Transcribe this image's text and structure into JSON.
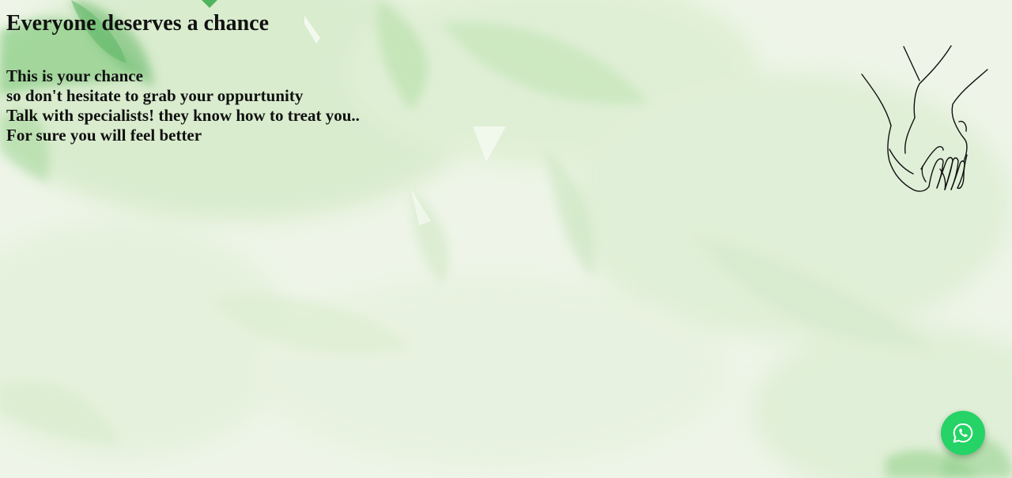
{
  "page": {
    "heading": "Everyone deserves a chance",
    "lines": [
      "This is your chance",
      "so don't hesitate to grab your oppurtunity",
      "Talk with specialists! they know how to treat you..",
      "For sure you will feel better"
    ]
  },
  "decor": {
    "illustration_icon": "holding-hands-line-art",
    "background": "green-watercolor-leaves"
  },
  "whatsapp": {
    "icon": "whatsapp-icon",
    "color": "#25d366"
  },
  "colors": {
    "background": "#eef5e8",
    "leaf_dark": "#6fbf73",
    "leaf_light": "#d6ebcc",
    "text": "#111111"
  }
}
